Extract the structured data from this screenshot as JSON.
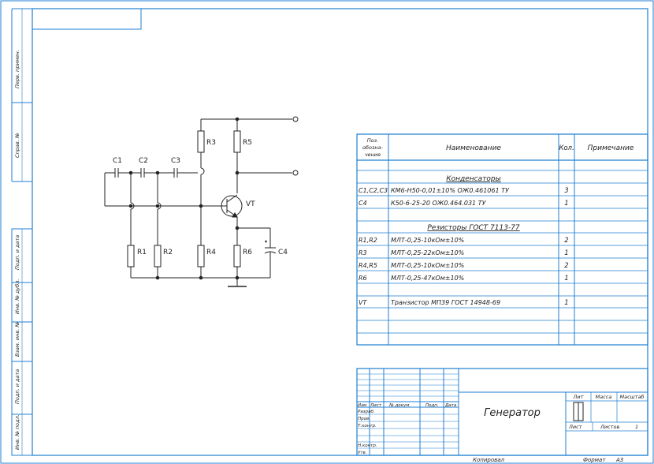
{
  "colors": {
    "frame": "#1f7fd0",
    "ink": "#222222"
  },
  "left_strip": {
    "perv_primen": "Перв. примен.",
    "sprav_no": "Справ. №",
    "podp_data_1": "Подп. и дата",
    "inv_dubl": "Инв. № дубл.",
    "vzam_inv": "Взам. инв. №",
    "podp_data_2": "Подп. и дата",
    "inv_podl": "Инв. № подл."
  },
  "schematic": {
    "labels": {
      "c1": "C1",
      "c2": "C2",
      "c3": "C3",
      "c4": "C4",
      "r1": "R1",
      "r2": "R2",
      "r3": "R3",
      "r4": "R4",
      "r5": "R5",
      "r6": "R6",
      "vt": "VT"
    }
  },
  "parts_list": {
    "headers": {
      "pos_l1": "Поз.",
      "pos_l2": "обозна-",
      "pos_l3": "чение",
      "name": "Наименование",
      "qty": "Кол.",
      "note": "Примечание"
    },
    "section_capacitors": "Конденсаторы",
    "section_resistors": "Резисторы ГОСТ 7113-77",
    "rows": [
      {
        "pos": "C1,C2,C3",
        "name": "КМ6-Н50-0,01±10% ОЖ0.461061 ТУ",
        "qty": "3"
      },
      {
        "pos": "C4",
        "name": "К50-6-25-20 ОЖ0.464.031 ТУ",
        "qty": "1"
      },
      {
        "pos": "R1,R2",
        "name": "МЛТ-0,25-10кОм±10%",
        "qty": "2"
      },
      {
        "pos": "R3",
        "name": "МЛТ-0,25-22кОм±10%",
        "qty": "1"
      },
      {
        "pos": "R4,R5",
        "name": "МЛТ-0,25-10кОм±10%",
        "qty": "2"
      },
      {
        "pos": "R6",
        "name": "МЛТ-0,25-47кОм±10%",
        "qty": "1"
      },
      {
        "pos": "VT",
        "name": "Транзистор МП39 ГОСТ 14948-69",
        "qty": "1"
      }
    ]
  },
  "title_block": {
    "izm": "Изм",
    "list": "Лист",
    "doc_no": "№ докум.",
    "podp": "Подп.",
    "data": "Дата",
    "razrab": "Разраб.",
    "prov": "Пров.",
    "t_kontr": "Т.контр.",
    "n_kontr": "Н.контр.",
    "utv": "Утв.",
    "title": "Генератор",
    "lit": "Лит",
    "massa": "Масса",
    "masshtab": "Масштаб",
    "list2": "Лист",
    "listov": "Листов",
    "listov_value": "1"
  },
  "footer": {
    "kopiroval": "Копировал",
    "format": "Формат",
    "format_value": "А3"
  }
}
